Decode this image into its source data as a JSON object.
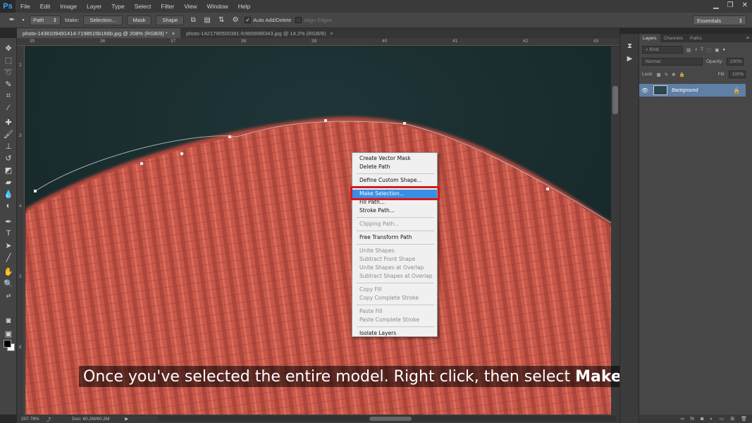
{
  "app": {
    "logo": "Ps"
  },
  "menubar": {
    "items": [
      "File",
      "Edit",
      "Image",
      "Layer",
      "Type",
      "Select",
      "Filter",
      "View",
      "Window",
      "Help"
    ]
  },
  "window_controls": {
    "minimize": "▁",
    "restore": "❐",
    "close": "✕"
  },
  "options_bar": {
    "tool_mode": "Path",
    "make_label": "Make:",
    "selection_btn": "Selection...",
    "mask_btn": "Mask",
    "shape_btn": "Shape",
    "auto_add_delete": "Auto Add/Delete",
    "auto_add_delete_checked": "✓",
    "align_edges": "Align Edges",
    "workspace": "Essentials"
  },
  "tabs": [
    {
      "label": "photo-1438109491414-7198515b166b.jpg @ 208% (RGB/8) *",
      "close": "×"
    },
    {
      "label": "photo-1421790500381-fc9b5996f343.jpg @ 14.2% (RGB/8)",
      "close": "×"
    }
  ],
  "ruler": {
    "top": [
      "35",
      "36",
      "37",
      "38",
      "39",
      "40",
      "41",
      "42",
      "43"
    ],
    "left": [
      "2",
      "3",
      "4",
      "5",
      "6"
    ]
  },
  "context_menu": {
    "items": [
      {
        "label": "Create Vector Mask",
        "state": "enabled"
      },
      {
        "label": "Delete Path",
        "state": "enabled"
      },
      {
        "sep": true
      },
      {
        "label": "Define Custom Shape...",
        "state": "enabled"
      },
      {
        "sep": true
      },
      {
        "label": "Make Selection...",
        "state": "highlighted"
      },
      {
        "label": "Fill Path...",
        "state": "enabled"
      },
      {
        "label": "Stroke Path...",
        "state": "enabled"
      },
      {
        "sep": true
      },
      {
        "label": "Clipping Path...",
        "state": "disabled"
      },
      {
        "sep": true
      },
      {
        "label": "Free Transform Path",
        "state": "enabled"
      },
      {
        "sep": true
      },
      {
        "label": "Unite Shapes",
        "state": "disabled"
      },
      {
        "label": "Subtract Front Shape",
        "state": "disabled"
      },
      {
        "label": "Unite Shapes at Overlap",
        "state": "disabled"
      },
      {
        "label": "Subtract Shapes at Overlap",
        "state": "disabled"
      },
      {
        "sep": true
      },
      {
        "label": "Copy Fill",
        "state": "disabled"
      },
      {
        "label": "Copy Complete Stroke",
        "state": "disabled"
      },
      {
        "sep": true
      },
      {
        "label": "Paste Fill",
        "state": "disabled"
      },
      {
        "label": "Paste Complete Stroke",
        "state": "disabled"
      },
      {
        "sep": true
      },
      {
        "label": "Isolate Layers",
        "state": "enabled"
      }
    ]
  },
  "subtitle": {
    "text": "Once you've selected the entire model. Right click, then select ",
    "bold": "Make Selection",
    "end": "."
  },
  "status": {
    "zoom": "207.78%",
    "doc": "Doc: 60.2M/60.2M"
  },
  "layers_panel": {
    "tabs": [
      "Layers",
      "Channels",
      "Paths"
    ],
    "filter_kind": "Kind",
    "blend_mode": "Normal",
    "opacity_label": "Opacity:",
    "opacity_value": "100%",
    "lock_label": "Lock:",
    "fill_label": "Fill:",
    "fill_value": "100%",
    "layer_name": "Background"
  },
  "colors": {
    "canvas_bg": "#1a2c2d",
    "hat": "#c9584a",
    "highlight": "#3a8ee6",
    "callout": "#d41a1a",
    "layer_selected": "#5f7fa5"
  }
}
